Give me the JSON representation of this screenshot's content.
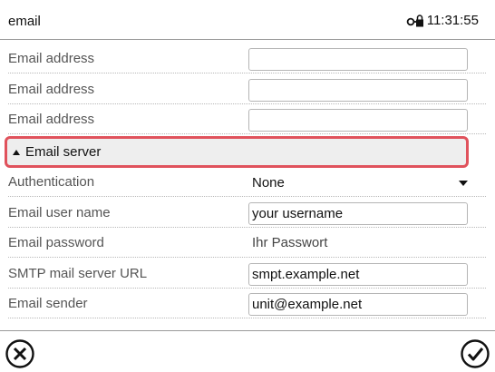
{
  "header": {
    "title": "email",
    "time": "11:31:55",
    "status_icon": "key-lock-icon"
  },
  "email_addresses": [
    {
      "label": "Email address",
      "value": ""
    },
    {
      "label": "Email address",
      "value": ""
    },
    {
      "label": "Email address",
      "value": ""
    }
  ],
  "section": {
    "label": "Email server",
    "expanded": true,
    "highlight_color": "#e0525c"
  },
  "server": {
    "authentication": {
      "label": "Authentication",
      "value": "None"
    },
    "user_name": {
      "label": "Email user name",
      "value": "your username"
    },
    "password": {
      "label": "Email password",
      "value": "Ihr Passwort"
    },
    "smtp_url": {
      "label": "SMTP mail server URL",
      "value": "smpt.example.net"
    },
    "sender": {
      "label": "Email sender",
      "value": "unit@example.net"
    }
  },
  "footer": {
    "cancel_icon": "cancel-circle-x-icon",
    "confirm_icon": "confirm-circle-check-icon"
  }
}
